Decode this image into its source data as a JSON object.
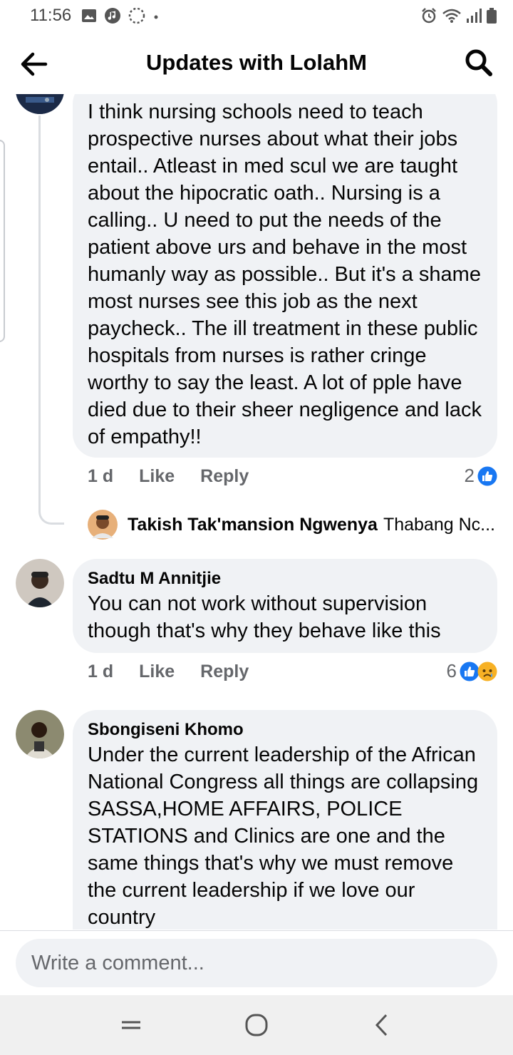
{
  "status_bar": {
    "time": "11:56"
  },
  "header": {
    "title": "Updates with LolahM"
  },
  "comments": [
    {
      "text": "I think nursing schools need to teach prospective nurses about what their jobs entail.. Atleast in med scul we are taught about the hipocratic oath.. Nursing is a calling.. U need to put the needs of the patient above urs and behave in the most humanly way as possible.. But it's a shame most nurses see this job as the next paycheck.. The ill treatment in these public hospitals from nurses is rather cringe worthy to say the least. A lot of pple have died due to their sheer negligence and lack of empathy!!",
      "time": "1 d",
      "like_label": "Like",
      "reply_label": "Reply",
      "reaction_count": "2",
      "reactions": [
        "like-icon"
      ],
      "reply_preview": {
        "author": "Takish Tak'mansion Ngwenya",
        "text": "Thabang Nc..."
      }
    },
    {
      "author": "Sadtu M Annitjie",
      "text": "You can not work without supervision though that's why they behave like this",
      "time": "1 d",
      "like_label": "Like",
      "reply_label": "Reply",
      "reaction_count": "6",
      "reactions": [
        "like-icon",
        "sad-icon"
      ]
    },
    {
      "author": "Sbongiseni Khomo",
      "text": "Under the current leadership of the African National Congress all things are collapsing SASSA,HOME AFFAIRS, POLICE STATIONS and Clinics are one and the same things that's why we must remove the current leadership if we love our country"
    }
  ],
  "composer": {
    "placeholder": "Write a comment..."
  },
  "colors": {
    "accent": "#1877f2",
    "bubble": "#f0f2f5",
    "meta": "#65676b",
    "sad": "#f7b125"
  }
}
